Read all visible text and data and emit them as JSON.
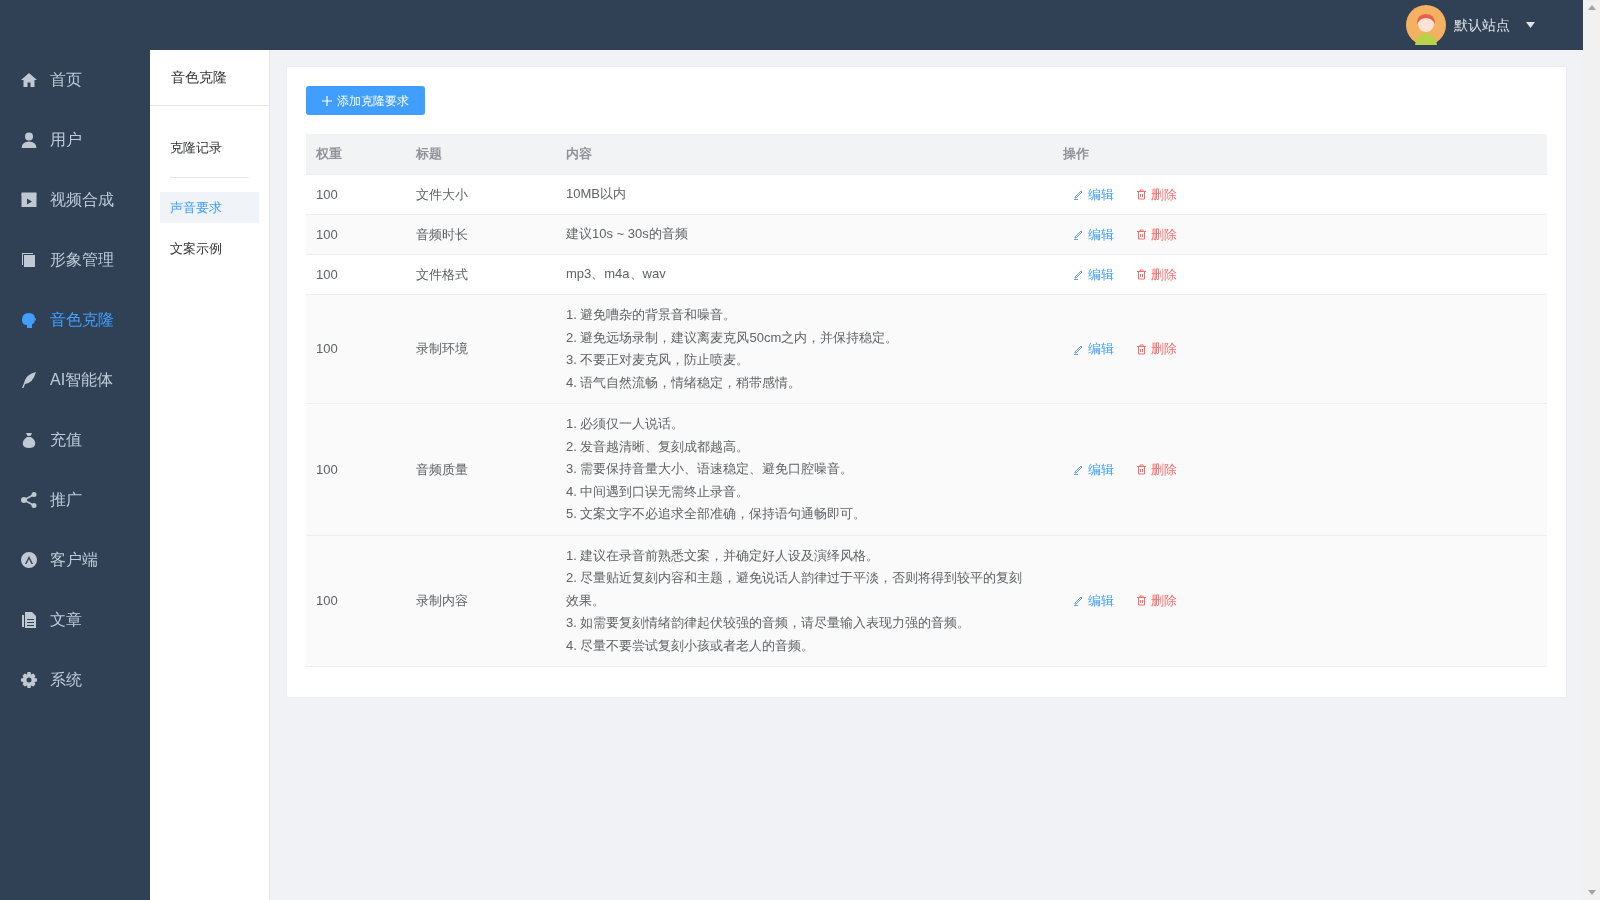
{
  "header": {
    "site_name": "默认站点"
  },
  "sidebar": {
    "items": [
      {
        "label": "首页",
        "selected": false
      },
      {
        "label": "用户",
        "selected": false
      },
      {
        "label": "视频合成",
        "selected": false
      },
      {
        "label": "形象管理",
        "selected": false
      },
      {
        "label": "音色克隆",
        "selected": true
      },
      {
        "label": "AI智能体",
        "selected": false
      },
      {
        "label": "充值",
        "selected": false
      },
      {
        "label": "推广",
        "selected": false
      },
      {
        "label": "客户端",
        "selected": false
      },
      {
        "label": "文章",
        "selected": false
      },
      {
        "label": "系统",
        "selected": false
      }
    ]
  },
  "subnav": {
    "title": "音色克隆",
    "items": [
      {
        "label": "克隆记录",
        "selected": false
      },
      {
        "label": "声音要求",
        "selected": true
      },
      {
        "label": "文案示例",
        "selected": false
      }
    ]
  },
  "add_button": "添加克隆要求",
  "table": {
    "columns": [
      "权重",
      "标题",
      "内容",
      "操作"
    ],
    "rows": [
      {
        "weight": "100",
        "title": "文件大小",
        "content": [
          "10MB以内"
        ],
        "edit": "编辑",
        "delete": "删除"
      },
      {
        "weight": "100",
        "title": "音频时长",
        "content": [
          "建议10s ~ 30s的音频"
        ],
        "edit": "编辑",
        "delete": "删除"
      },
      {
        "weight": "100",
        "title": "文件格式",
        "content": [
          "mp3、m4a、wav"
        ],
        "edit": "编辑",
        "delete": "删除"
      },
      {
        "weight": "100",
        "title": "录制环境",
        "content": [
          "1. 避免嘈杂的背景音和噪音。",
          "2. 避免远场录制，建议离麦克风50cm之内，并保持稳定。",
          "3. 不要正对麦克风，防止喷麦。",
          "4. 语气自然流畅，情绪稳定，稍带感情。"
        ],
        "edit": "编辑",
        "delete": "删除"
      },
      {
        "weight": "100",
        "title": "音频质量",
        "content": [
          "1. 必须仅一人说话。",
          "2. 发音越清晰、复刻成都越高。",
          "3. 需要保持音量大小、语速稳定、避免口腔噪音。",
          "4. 中间遇到口误无需终止录音。",
          "5. 文案文字不必追求全部准确，保持语句通畅即可。"
        ],
        "edit": "编辑",
        "delete": "删除"
      },
      {
        "weight": "100",
        "title": "录制内容",
        "content": [
          "1. 建议在录音前熟悉文案，并确定好人设及演绎风格。",
          "2. 尽量贴近复刻内容和主题，避免说话人韵律过于平淡，否则将得到较平的复刻效果。",
          "3. 如需要复刻情绪韵律起伏较强的音频，请尽量输入表现力强的音频。",
          "4. 尽量不要尝试复刻小孩或者老人的音频。"
        ],
        "edit": "编辑",
        "delete": "删除"
      }
    ]
  }
}
